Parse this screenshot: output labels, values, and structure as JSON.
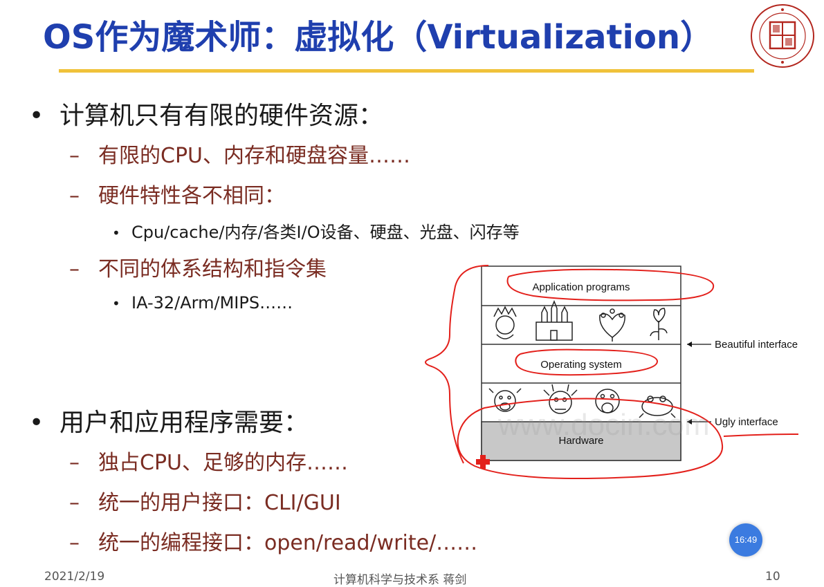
{
  "slide": {
    "title": "OS作为魔术师：虚拟化（Virtualization）",
    "bullets": [
      {
        "text": "计算机只有有限的硬件资源：",
        "bullet": "•"
      },
      {
        "text": "有限的CPU、内存和硬盘容量……",
        "bullet": "–"
      },
      {
        "text": "硬件特性各不相同：",
        "bullet": "–"
      },
      {
        "text": "Cpu/cache/内存/各类I/O设备、硬盘、光盘、闪存等",
        "bullet": "•"
      },
      {
        "text": "不同的体系结构和指令集",
        "bullet": "–"
      },
      {
        "text": "IA-32/Arm/MIPS……",
        "bullet": "•"
      },
      {
        "text": "用户和应用程序需要：",
        "bullet": "•"
      },
      {
        "text": "独占CPU、足够的内存……",
        "bullet": "–"
      },
      {
        "text": "统一的用户接口：CLI/GUI",
        "bullet": "–"
      },
      {
        "text": "统一的编程接口：open/read/write/……",
        "bullet": "–"
      }
    ]
  },
  "diagram": {
    "layers": [
      "Application programs",
      "Operating system",
      "Hardware"
    ],
    "labels": {
      "beautiful": "Beautiful interface",
      "ugly": "Ugly interface"
    }
  },
  "footer": {
    "date": "2021/2/19",
    "author": "计算机科学与技术系 蒋剑",
    "page": "10"
  },
  "overlay": {
    "clock": "16:49",
    "watermark": "www.docin.com"
  },
  "colors": {
    "title": "#1f3fae",
    "rule": "#f0c23a",
    "sub_bullet": "#7a2c22",
    "annotation": "#e3201b",
    "hardware_fill": "#c8c8c8"
  }
}
